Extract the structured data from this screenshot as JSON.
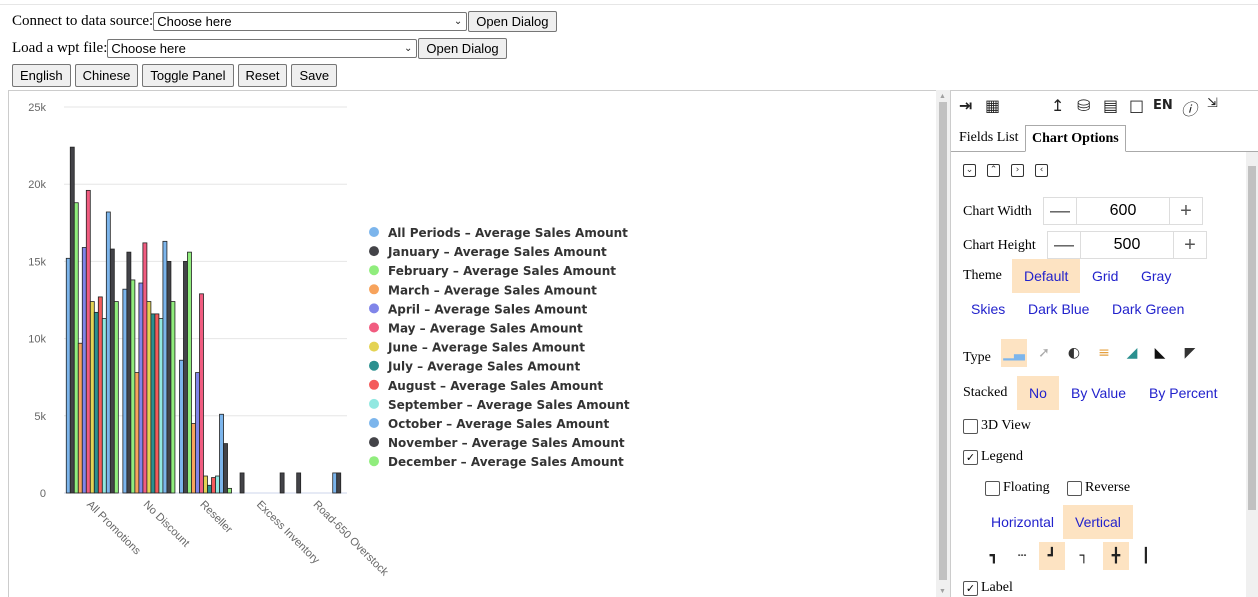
{
  "controls": {
    "connect_label": "Connect to data source:",
    "connect_value": "Choose here",
    "connect_button": "Open Dialog",
    "wpt_label": "Load a wpt file:",
    "wpt_value": "Choose here",
    "wpt_button": "Open Dialog",
    "buttons": [
      "English",
      "Chinese",
      "Toggle Panel",
      "Reset",
      "Save"
    ]
  },
  "toolbar": {
    "icons": [
      "collapse-panel-icon",
      "grid-icon",
      "export-icon",
      "database-icon",
      "save-icon",
      "new-document-icon",
      "language-icon",
      "info-icon",
      "fullscreen-icon"
    ],
    "language": "EN"
  },
  "tabs": [
    "Fields List",
    "Chart Options"
  ],
  "active_tab": "Chart Options",
  "options": {
    "chart_width_label": "Chart Width",
    "chart_width": "600",
    "chart_height_label": "Chart Height",
    "chart_height": "500",
    "theme_label": "Theme",
    "themes": [
      "Default",
      "Grid",
      "Gray",
      "Skies",
      "Dark Blue",
      "Dark Green"
    ],
    "theme_selected": "Default",
    "type_label": "Type",
    "type_icons": [
      "column-chart-icon",
      "line-chart-icon",
      "pie-chart-icon",
      "bar-chart-icon",
      "area-chart-icon",
      "filled-area-icon",
      "stacked-area-icon"
    ],
    "type_selected": "column-chart-icon",
    "stacked_label": "Stacked",
    "stacked_options": [
      "No",
      "By Value",
      "By Percent"
    ],
    "stacked_selected": "No",
    "view3d_label": "3D View",
    "view3d_checked": false,
    "legend_label": "Legend",
    "legend_checked": true,
    "floating_label": "Floating",
    "floating_checked": false,
    "reverse_label": "Reverse",
    "reverse_checked": false,
    "orientations": [
      "Horizontal",
      "Vertical"
    ],
    "orientation_selected": "Vertical",
    "label_label": "Label",
    "label_checked": true
  },
  "chart_data": {
    "type": "bar",
    "categories": [
      "All Promotions",
      "No Discount",
      "Reseller",
      "Excess Inventory",
      "Road-650 Overstock"
    ],
    "ylim": [
      0,
      25000
    ],
    "yticks": [
      "0",
      "5k",
      "10k",
      "15k",
      "20k",
      "25k"
    ],
    "legend_placement": "right",
    "series": [
      {
        "name": "All Periods – Average Sales Amount",
        "color": "#7cb5ec",
        "values": [
          15200,
          13200,
          8600,
          0,
          0
        ]
      },
      {
        "name": "January – Average Sales Amount",
        "color": "#434348",
        "values": [
          22400,
          15600,
          15000,
          1300,
          1300
        ]
      },
      {
        "name": "February – Average Sales Amount",
        "color": "#90ed7d",
        "values": [
          18800,
          13800,
          15600,
          0,
          0
        ]
      },
      {
        "name": "March – Average Sales Amount",
        "color": "#f7a35c",
        "values": [
          9700,
          7800,
          4500,
          0,
          0
        ]
      },
      {
        "name": "April – Average Sales Amount",
        "color": "#8085e9",
        "values": [
          15900,
          13600,
          7800,
          0,
          0
        ]
      },
      {
        "name": "May – Average Sales Amount",
        "color": "#f15c80",
        "values": [
          19600,
          16200,
          12900,
          0,
          0
        ]
      },
      {
        "name": "June – Average Sales Amount",
        "color": "#e4d354",
        "values": [
          12400,
          12400,
          1100,
          0,
          0
        ]
      },
      {
        "name": "July – Average Sales Amount",
        "color": "#2b908f",
        "values": [
          11700,
          11600,
          500,
          0,
          0
        ]
      },
      {
        "name": "August – Average Sales Amount",
        "color": "#f45b5b",
        "values": [
          12700,
          11600,
          1000,
          0,
          0
        ]
      },
      {
        "name": "September – Average Sales Amount",
        "color": "#91e8e1",
        "values": [
          11300,
          11300,
          1100,
          0,
          0
        ]
      },
      {
        "name": "October – Average Sales Amount",
        "color": "#7cb5ec",
        "values": [
          18200,
          16300,
          5100,
          0,
          1300
        ]
      },
      {
        "name": "November – Average Sales Amount",
        "color": "#434348",
        "values": [
          15800,
          15000,
          3200,
          1300,
          1300
        ]
      },
      {
        "name": "December – Average Sales Amount",
        "color": "#90ed7d",
        "values": [
          12400,
          12400,
          300,
          0,
          0
        ]
      }
    ]
  }
}
